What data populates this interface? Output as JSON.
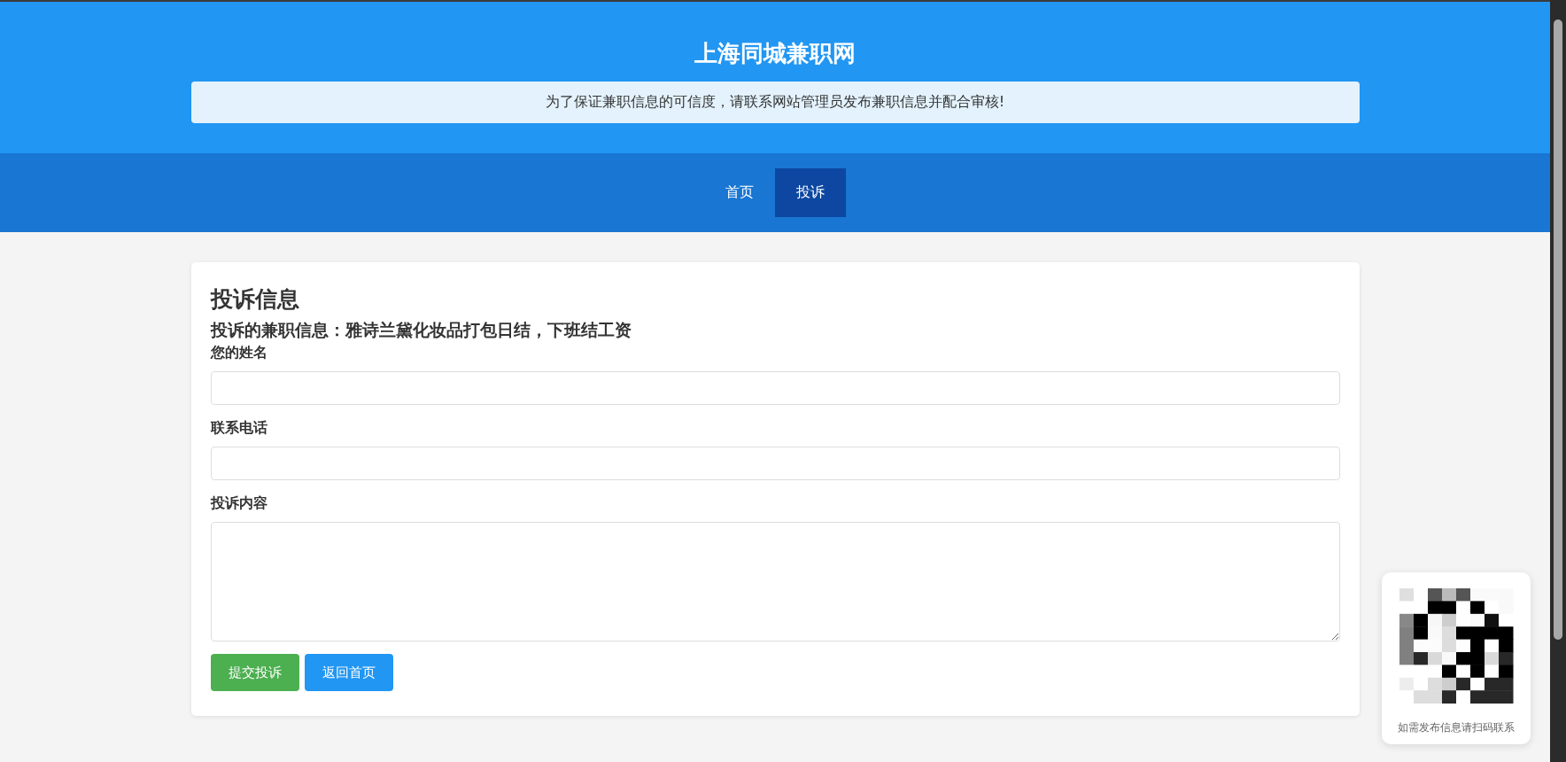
{
  "header": {
    "title": "上海同城兼职网",
    "notice": "为了保证兼职信息的可信度，请联系网站管理员发布兼职信息并配合审核!"
  },
  "nav": [
    {
      "label": "首页",
      "selected": false
    },
    {
      "label": "投诉",
      "selected": true
    }
  ],
  "form": {
    "heading": "投诉信息",
    "subject": "投诉的兼职信息：雅诗兰黛化妆品打包日结，下班结工资",
    "fields": [
      {
        "label": "您的姓名",
        "kind": "input"
      },
      {
        "label": "联系电话",
        "kind": "input"
      },
      {
        "label": "投诉内容",
        "kind": "textarea"
      }
    ],
    "buttons": [
      {
        "label": "提交投诉",
        "kind": "submit"
      },
      {
        "label": "返回首页",
        "kind": "back"
      }
    ]
  },
  "qr_card": {
    "caption": "如需发布信息请扫码联系"
  }
}
